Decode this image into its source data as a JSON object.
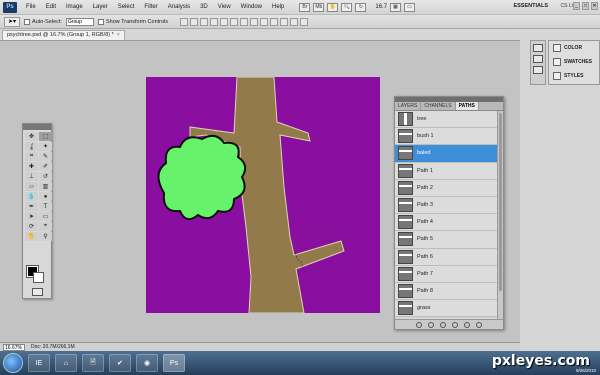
{
  "app": {
    "logo": "Ps",
    "menus": [
      "File",
      "Edit",
      "Image",
      "Layer",
      "Select",
      "Filter",
      "Analysis",
      "3D",
      "View",
      "Window",
      "Help"
    ],
    "zoom_display": "16.7",
    "workspace": "ESSENTIALS",
    "cs_live": "CS Live",
    "window_controls": [
      "_",
      "□",
      "✕"
    ]
  },
  "options": {
    "auto_select_label": "Auto-Select:",
    "auto_select_value": "Group",
    "transform_controls_label": "Show Transform Controls"
  },
  "document": {
    "tab_title": "psychtree.psd @ 16.7% (Group 1, RGB/8) *",
    "close": "×"
  },
  "colors": {
    "canvas": "#8a0ea0",
    "trunk": "#927a4a",
    "bush": "#66f26a",
    "selection": "#3f8fd8"
  },
  "paths_panel": {
    "tabs": [
      "LAYERS",
      "CHANNELS",
      "PATHS"
    ],
    "active_tab": "PATHS",
    "rows": [
      "tree",
      "bush 1",
      "baled",
      "Path 1",
      "Path 2",
      "Path 3",
      "Path 4",
      "Path 5",
      "Path 6",
      "Path 7",
      "Path 8",
      "grass"
    ],
    "selected": "baled"
  },
  "dock": {
    "items": [
      "COLOR",
      "SWATCHES",
      "STYLES"
    ]
  },
  "status": {
    "zoom": "16.67%",
    "doc": "Doc: 20.7M/266.1M"
  },
  "taskbar": {
    "apps": [
      "IE",
      "⌂",
      "🗎",
      "✔",
      "◉",
      "Ps"
    ],
    "watermark": "pxleyes.com",
    "date": "9/26/2010"
  }
}
